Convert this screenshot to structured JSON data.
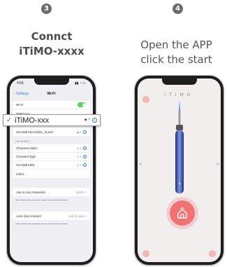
{
  "steps": [
    {
      "number": "3",
      "caption_lines": [
        "Connct",
        "iTiMO-xxxx"
      ]
    },
    {
      "number": "4",
      "caption_lines": [
        "Open the APP",
        "click the start"
      ]
    }
  ],
  "wifi_screen": {
    "status_time": "4:55",
    "back_label": "Settings",
    "nav_title": "Wi-Fi",
    "wifi_row_label": "Wi-Fi",
    "wifi_enabled": true,
    "connected_network": "iTiMO-xxx",
    "my_networks_header": "MY NETWORKS",
    "my_networks": [
      "HUAWEI-BAIANSL_Guest"
    ],
    "networks_header": "NETWORKS",
    "networks": [
      "Chinanet-4wk2",
      "Chinanet-fygh",
      "HUAWEI-BM",
      "Other..."
    ],
    "ask_to_join_label": "Ask to Join Networks",
    "ask_to_join_value": "Notify >",
    "auto_join_label": "Auto-Join Hotspot",
    "auto_join_value": "Ask to Join >",
    "accent_color": "#2f7cf6",
    "toggle_color": "#4cd964"
  },
  "app_screen": {
    "brand": "iTiMO",
    "start_button_color": "#f07272",
    "accent_pink": "#f2b8b8"
  }
}
